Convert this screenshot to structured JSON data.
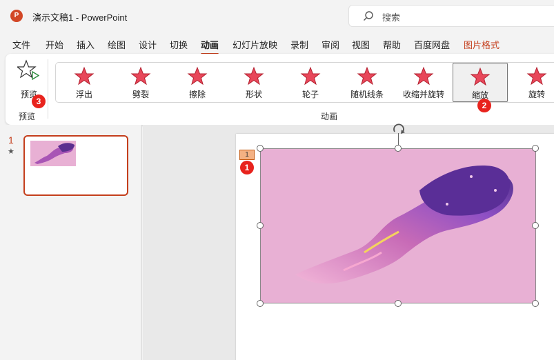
{
  "titlebar": {
    "app_icon_letter": "P",
    "title": "演示文稿1  -  PowerPoint",
    "search_placeholder": "搜索"
  },
  "menu": {
    "items": [
      "文件",
      "开始",
      "插入",
      "绘图",
      "设计",
      "切换",
      "动画",
      "幻灯片放映",
      "录制",
      "审阅",
      "视图",
      "帮助",
      "百度网盘",
      "图片格式"
    ],
    "active": "动画",
    "accent_item": "图片格式"
  },
  "ribbon": {
    "preview_label": "预览",
    "preview_group_label": "预览",
    "animation_group_label": "动画",
    "animations": [
      "浮出",
      "劈裂",
      "擦除",
      "形状",
      "轮子",
      "随机线条",
      "收缩并旋转",
      "缩放",
      "旋转"
    ],
    "selected_animation": "缩放"
  },
  "badges": {
    "slide_tag": "1",
    "zoom": "2",
    "preview": "3"
  },
  "slide_panel": {
    "slide_number": "1",
    "animation_marker": "★"
  },
  "slide": {
    "animation_tag": "1"
  },
  "icons": {
    "app": "powerpoint-icon",
    "search": "search-icon",
    "preview": "star-play-icon",
    "animation": "star-effect-icon",
    "rotate": "rotate-handle-icon"
  },
  "colors": {
    "accent": "#c43e1c",
    "badge": "#e8231d",
    "picture_bg": "#e8b0d4",
    "star_fill": "#e8475a"
  }
}
